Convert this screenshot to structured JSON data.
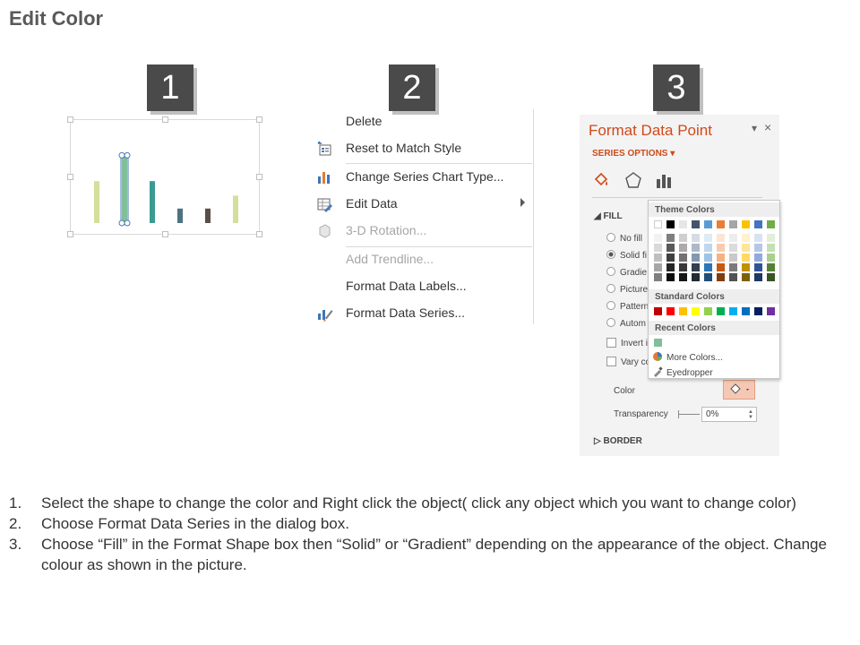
{
  "page": {
    "title": "Edit Color"
  },
  "steps": [
    "1",
    "2",
    "3"
  ],
  "mini_chart": {
    "bars": [
      {
        "value": 52,
        "color": "#d3df9b",
        "selected": false
      },
      {
        "value": 84,
        "color": "#7fbf9b",
        "selected": true
      },
      {
        "value": 52,
        "color": "#3a9b93",
        "selected": false
      },
      {
        "value": 18,
        "color": "#4b7480",
        "selected": false
      },
      {
        "value": 18,
        "color": "#5a4e46",
        "selected": false
      },
      {
        "value": 34,
        "color": "#d3df9b",
        "selected": false
      }
    ],
    "max": 100
  },
  "context_menu": {
    "items": [
      {
        "label": "Delete",
        "icon": "none",
        "disabled": false
      },
      {
        "label": "Reset to Match Style",
        "icon": "reset-style-icon",
        "disabled": false
      },
      {
        "label": "Change Series Chart Type...",
        "icon": "bar-chart-icon",
        "disabled": false
      },
      {
        "label": "Edit Data",
        "icon": "edit-data-icon",
        "disabled": false,
        "submenu": true
      },
      {
        "label": "3-D Rotation...",
        "icon": "3d-rotation-icon",
        "disabled": true
      },
      {
        "label": "Add Trendline...",
        "icon": "none",
        "disabled": true
      },
      {
        "label": "Format Data Labels...",
        "icon": "none",
        "disabled": false
      },
      {
        "label": "Format Data Series...",
        "icon": "format-series-icon",
        "disabled": false
      }
    ]
  },
  "format_pane": {
    "title": "Format Data Point",
    "dropdown_glyph": "▾",
    "close_glyph": "×",
    "series_options": "SERIES OPTIONS ▾",
    "fill_section": "FILL",
    "fill_options": [
      {
        "label": "No fill",
        "type": "radio",
        "checked": false
      },
      {
        "label": "Solid fi",
        "type": "radio",
        "checked": true
      },
      {
        "label": "Gradie",
        "type": "radio",
        "checked": false
      },
      {
        "label": "Picture",
        "type": "radio",
        "checked": false
      },
      {
        "label": "Pattern",
        "type": "radio",
        "checked": false
      },
      {
        "label": "Autom",
        "type": "radio",
        "checked": false
      },
      {
        "label": "Invert i",
        "type": "checkbox",
        "checked": false
      },
      {
        "label": "Vary co",
        "type": "checkbox",
        "checked": false
      }
    ],
    "color_label": "Color",
    "transparency_label": "Transparency",
    "transparency_value": "0%",
    "border_section": "BORDER",
    "accent": "#d04a1a"
  },
  "color_popup": {
    "theme_header": "Theme Colors",
    "standard_header": "Standard Colors",
    "recent_header": "Recent Colors",
    "more_colors": "More Colors...",
    "eyedropper": "Eyedropper",
    "theme_top": [
      "#ffffff",
      "#000000",
      "#e7e6e6",
      "#44546a",
      "#5b9bd5",
      "#ed7d31",
      "#a5a5a5",
      "#ffc000",
      "#4472c4",
      "#70ad47"
    ],
    "theme_columns": [
      [
        "#f2f2f2",
        "#d9d9d9",
        "#bfbfbf",
        "#a6a6a6",
        "#7f7f7f"
      ],
      [
        "#7f7f7f",
        "#595959",
        "#404040",
        "#262626",
        "#0d0d0d"
      ],
      [
        "#d0cece",
        "#aeaaaa",
        "#757171",
        "#3a3838",
        "#171616"
      ],
      [
        "#d6dce4",
        "#adb9ca",
        "#8497b0",
        "#333f4f",
        "#222a35"
      ],
      [
        "#deebf6",
        "#bdd7ee",
        "#9dc3e6",
        "#2e75b6",
        "#1f4e79"
      ],
      [
        "#fbe5d5",
        "#f8cbad",
        "#f4b183",
        "#c55a11",
        "#833c0b"
      ],
      [
        "#ededed",
        "#dbdbdb",
        "#c9c9c9",
        "#7b7b7b",
        "#525252"
      ],
      [
        "#fff2cc",
        "#fee599",
        "#ffd965",
        "#bf9000",
        "#7f6000"
      ],
      [
        "#d9e2f3",
        "#b4c7e7",
        "#8faadc",
        "#2f5496",
        "#1f3864"
      ],
      [
        "#e2efd9",
        "#c5e0b3",
        "#a8d08d",
        "#538135",
        "#375623"
      ]
    ],
    "standard": [
      "#c00000",
      "#ff0000",
      "#ffc000",
      "#ffff00",
      "#92d050",
      "#00b050",
      "#00b0f0",
      "#0070c0",
      "#002060",
      "#7030a0"
    ],
    "recent": [
      "#7fbf9b"
    ]
  },
  "instructions": [
    {
      "num": "1.",
      "text": "Select the shape to change the color and Right click the object( click any object which you want to change color)"
    },
    {
      "num": "2.",
      "text": "Choose Format Data Series in the dialog box."
    },
    {
      "num": "3.",
      "text": "Choose “Fill” in the Format Shape box then “Solid” or “Gradient” depending on the appearance of the object. Change colour as shown in the picture."
    }
  ]
}
